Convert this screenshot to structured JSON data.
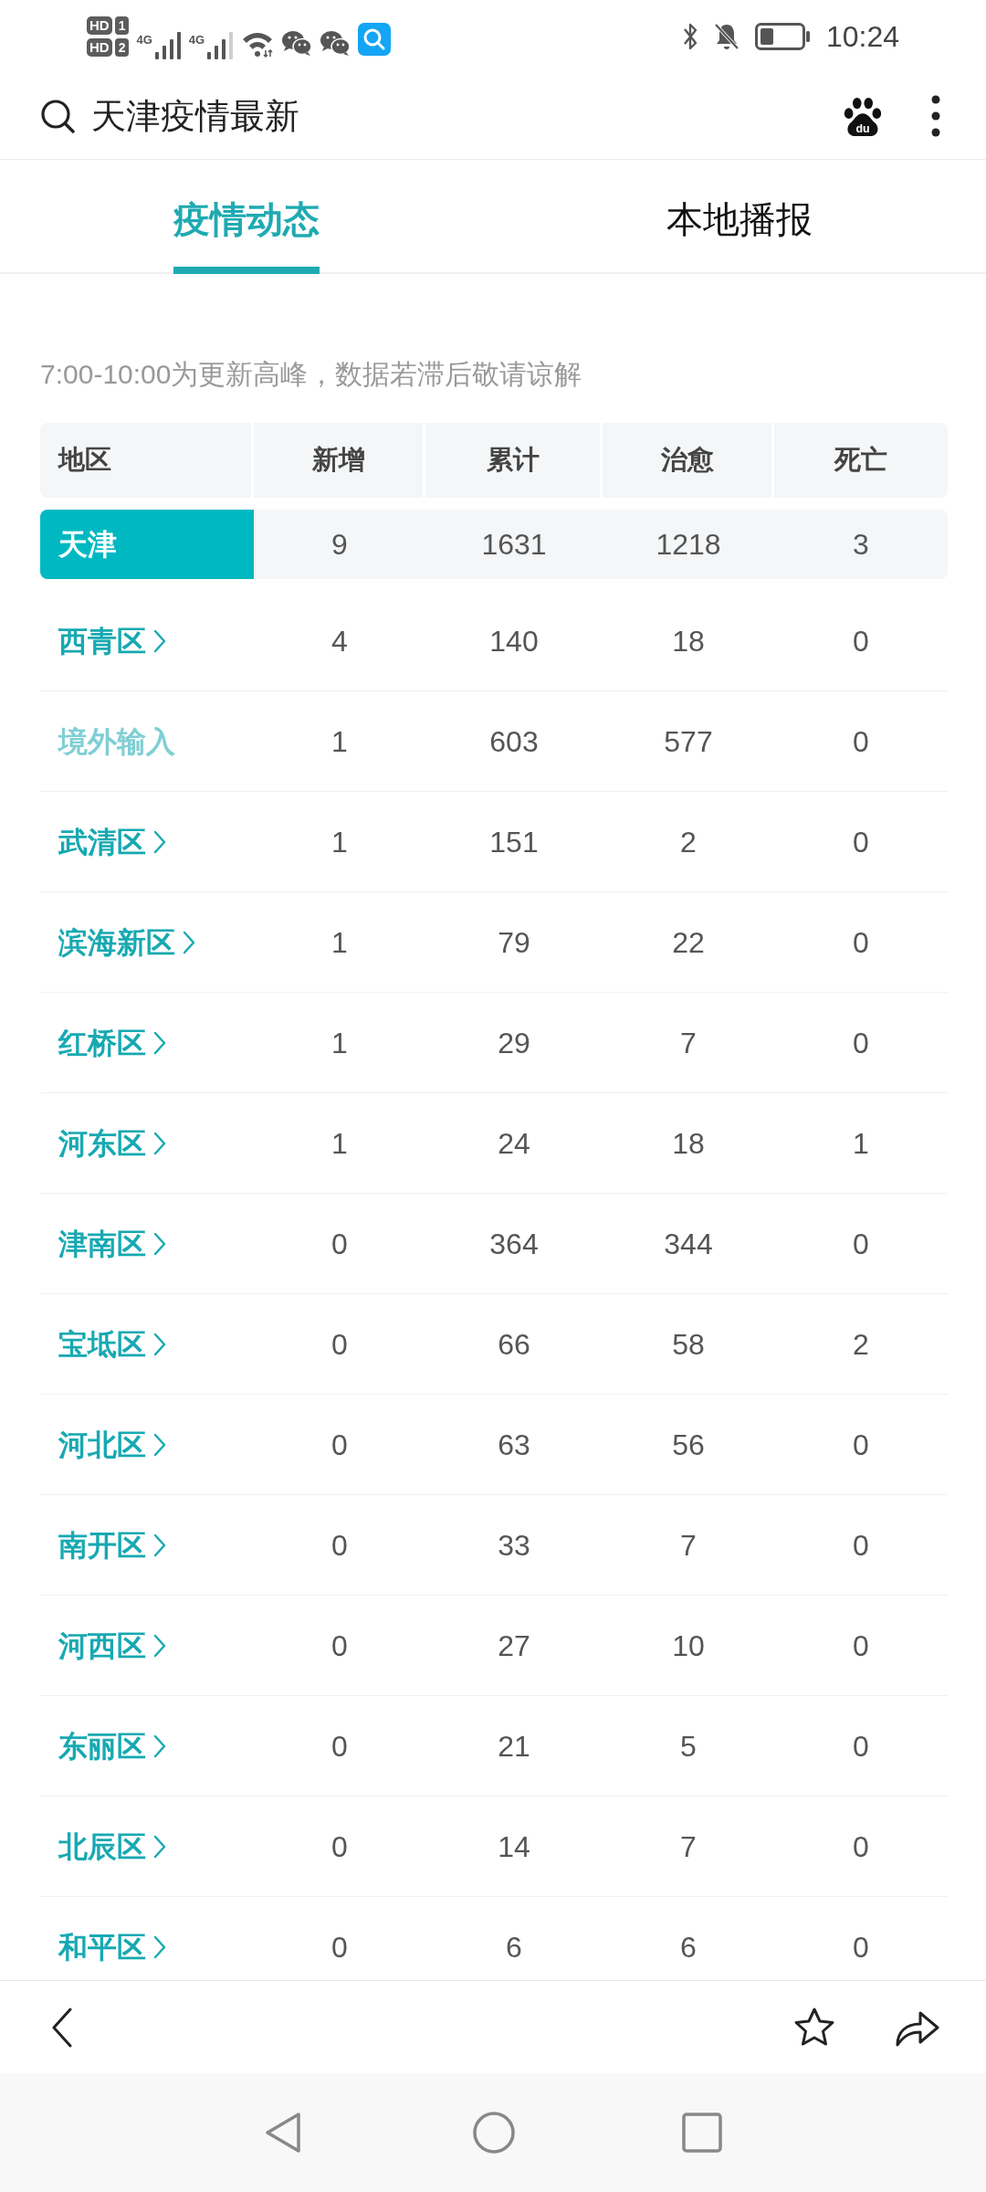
{
  "status_bar": {
    "sims": [
      {
        "badge": "HD",
        "slot": "1"
      },
      {
        "badge": "HD",
        "slot": "2"
      }
    ],
    "networks": [
      {
        "type": "4G"
      },
      {
        "type": "4G"
      }
    ],
    "time": "10:24"
  },
  "search_bar": {
    "query": "天津疫情最新",
    "logo_text": "du"
  },
  "tabs": [
    {
      "label": "疫情动态",
      "selected": true
    },
    {
      "label": "本地播报",
      "selected": false
    }
  ],
  "notice": "7:00-10:00为更新高峰，数据若滞后敬请谅解",
  "table": {
    "columns": [
      "地区",
      "新增",
      "累计",
      "治愈",
      "死亡"
    ],
    "summary": {
      "region": "天津",
      "new": "9",
      "total": "1631",
      "cured": "1218",
      "deaths": "3"
    },
    "rows": [
      {
        "region": "西青区",
        "kind": "link",
        "new": "4",
        "total": "140",
        "cured": "18",
        "deaths": "0"
      },
      {
        "region": "境外输入",
        "kind": "plain",
        "new": "1",
        "total": "603",
        "cured": "577",
        "deaths": "0"
      },
      {
        "region": "武清区",
        "kind": "link",
        "new": "1",
        "total": "151",
        "cured": "2",
        "deaths": "0"
      },
      {
        "region": "滨海新区",
        "kind": "link",
        "new": "1",
        "total": "79",
        "cured": "22",
        "deaths": "0"
      },
      {
        "region": "红桥区",
        "kind": "link",
        "new": "1",
        "total": "29",
        "cured": "7",
        "deaths": "0"
      },
      {
        "region": "河东区",
        "kind": "link",
        "new": "1",
        "total": "24",
        "cured": "18",
        "deaths": "1"
      },
      {
        "region": "津南区",
        "kind": "link",
        "new": "0",
        "total": "364",
        "cured": "344",
        "deaths": "0"
      },
      {
        "region": "宝坻区",
        "kind": "link",
        "new": "0",
        "total": "66",
        "cured": "58",
        "deaths": "2"
      },
      {
        "region": "河北区",
        "kind": "link",
        "new": "0",
        "total": "63",
        "cured": "56",
        "deaths": "0"
      },
      {
        "region": "南开区",
        "kind": "link",
        "new": "0",
        "total": "33",
        "cured": "7",
        "deaths": "0"
      },
      {
        "region": "河西区",
        "kind": "link",
        "new": "0",
        "total": "27",
        "cured": "10",
        "deaths": "0"
      },
      {
        "region": "东丽区",
        "kind": "link",
        "new": "0",
        "total": "21",
        "cured": "5",
        "deaths": "0"
      },
      {
        "region": "北辰区",
        "kind": "link",
        "new": "0",
        "total": "14",
        "cured": "7",
        "deaths": "0"
      },
      {
        "region": "和平区",
        "kind": "link",
        "new": "0",
        "total": "6",
        "cured": "6",
        "deaths": "0"
      }
    ]
  }
}
